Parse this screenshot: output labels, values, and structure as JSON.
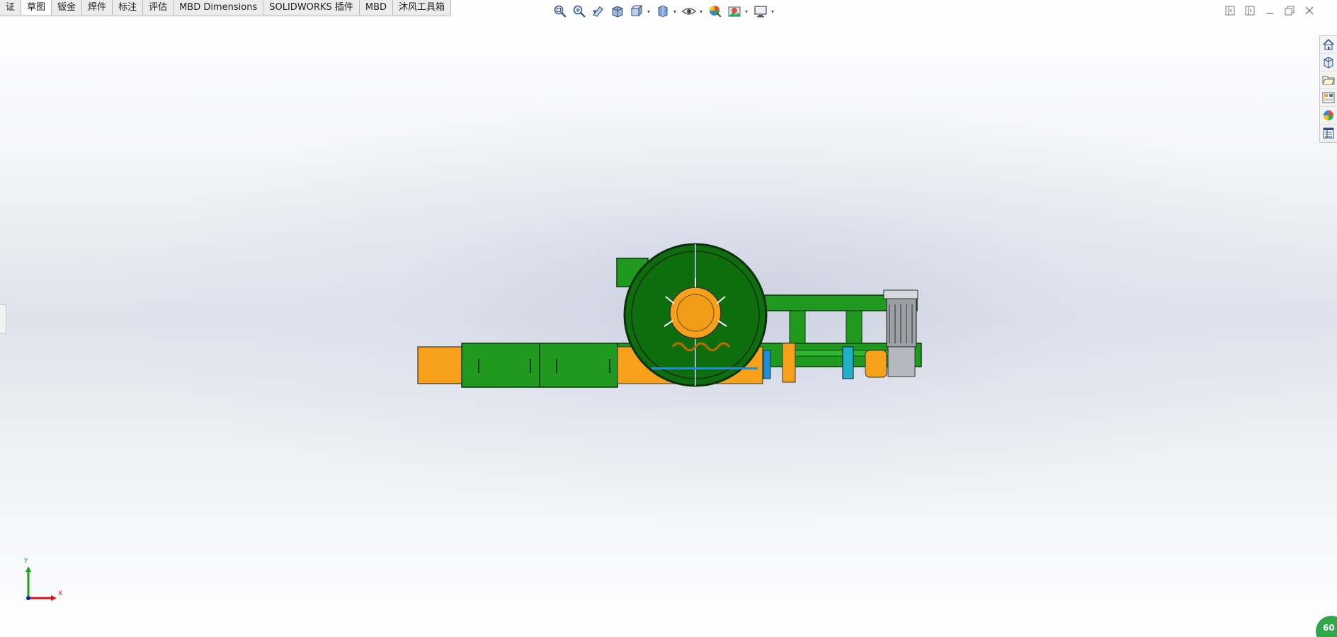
{
  "tabs": [
    {
      "label": "证",
      "active": false
    },
    {
      "label": "草图",
      "active": true
    },
    {
      "label": "钣金",
      "active": false
    },
    {
      "label": "焊件",
      "active": false
    },
    {
      "label": "标注",
      "active": false
    },
    {
      "label": "评估",
      "active": false
    },
    {
      "label": "MBD Dimensions",
      "active": false
    },
    {
      "label": "SOLIDWORKS 插件",
      "active": false
    },
    {
      "label": "MBD",
      "active": false
    },
    {
      "label": "沐风工具箱",
      "active": false
    }
  ],
  "hud_icons": [
    "zoom-to-fit-icon",
    "zoom-to-area-icon",
    "previous-view-icon",
    "section-view-icon",
    "view-orientation-icon",
    "display-style-icon",
    "hide-show-items-icon",
    "edit-appearance-icon",
    "apply-scene-icon",
    "view-settings-icon"
  ],
  "task_pane_icons": [
    "solidworks-resources-icon",
    "design-library-icon",
    "file-explorer-icon",
    "view-palette-icon",
    "appearances-icon",
    "custom-properties-icon"
  ],
  "triad": {
    "x_label": "X",
    "y_label": "Y"
  },
  "status_badge": {
    "text": "60"
  },
  "colors": {
    "frame_green": "#1f9a1f",
    "drum_green": "#0e6e0e",
    "orange": "#f7a01a",
    "motor_gray": "#9aa0a6",
    "blue": "#1e8fd6"
  }
}
